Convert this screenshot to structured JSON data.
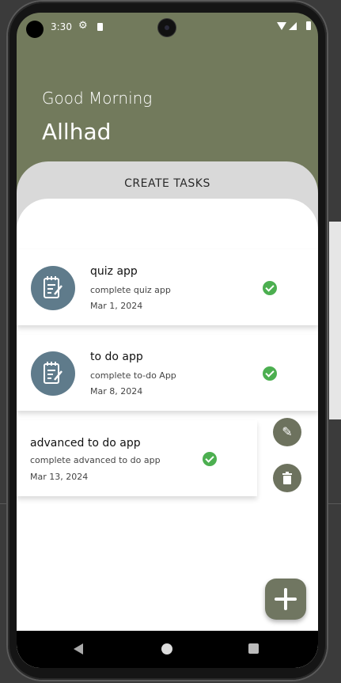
{
  "status_bar": {
    "time": "3:30",
    "icons": [
      "settings-icon",
      "sd-card-icon",
      "wifi-icon",
      "signal-icon",
      "battery-icon"
    ]
  },
  "header": {
    "greeting": "Good Morning",
    "user_name": "Allhad"
  },
  "section_title": "CREATE TASKS",
  "tasks": [
    {
      "title": "quiz app",
      "description": "complete quiz app",
      "date": "Mar 1, 2024",
      "completed": true,
      "icon": "notepad-icon"
    },
    {
      "title": "to do app",
      "description": "complete to-do App",
      "date": "Mar 8, 2024",
      "completed": true,
      "icon": "notepad-icon"
    },
    {
      "title": "advanced to do app",
      "description": "complete advanced to do app",
      "date": "Mar 13, 2024",
      "completed": true,
      "swiped_actions": [
        "edit-icon",
        "delete-icon"
      ]
    }
  ],
  "colors": {
    "accent": "#727a5c",
    "check": "#4caf50",
    "avatar": "#5f7b8b",
    "fab": "#707661"
  }
}
